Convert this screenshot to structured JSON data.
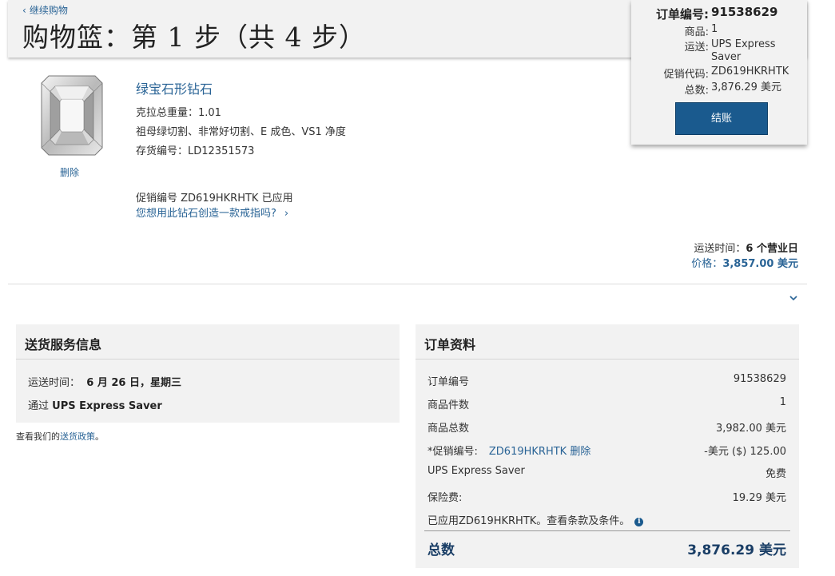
{
  "header": {
    "continue_label": "继续购物",
    "title": "购物篮：第 1 步（共 4 步）"
  },
  "summary": {
    "order_no_label": "订单编号:",
    "order_no": "91538629",
    "items_label": "商品:",
    "items": "1",
    "shipping_label": "运送:",
    "shipping": "UPS Express Saver",
    "promo_label": "促销代码:",
    "promo": "ZD619HKRHTK",
    "total_label": "总数:",
    "total": "3,876.29 美元",
    "checkout_label": "结账"
  },
  "item": {
    "name": "绿宝石形钻石",
    "carat": "克拉总重量：1.01",
    "desc": "祖母绿切割、非常好切割、E 成色、VS1 净度",
    "stock": "存货编号：LD12351573",
    "remove_label": "删除",
    "promo_applied": "促销编号 ZD619HKRHTK 已应用",
    "ring_link": "您想用此钻石创造一款戒指吗?",
    "ship_time_label": "运送时间：",
    "ship_time": "6 个营业日",
    "price_label": "价格：",
    "price": "3,857.00 美元"
  },
  "delivery": {
    "title": "送货服务信息",
    "time_label": "运送时间：",
    "time_value": "6 月 26 日，星期三",
    "via_label": "通过",
    "via_value": "UPS Express Saver",
    "policy_prefix": "查看我们的",
    "policy_link": "送货政策",
    "policy_suffix": "。"
  },
  "order": {
    "title": "订单资料",
    "rows": [
      {
        "label": "订单编号",
        "value": "91538629"
      },
      {
        "label": "商品件数",
        "value": "1"
      },
      {
        "label": "商品总数",
        "value": "3,982.00 美元"
      },
      {
        "label": "*促销编号:",
        "code": "ZD619HKRHTK 删除",
        "value": "-美元 ($) 125.00"
      },
      {
        "label": "UPS Express Saver",
        "value": "免费"
      },
      {
        "label": "保险费:",
        "value": "19.29 美元"
      }
    ],
    "applied_note": "已应用ZD619HKRHTK。查看条款及条件。",
    "total_label": "总数",
    "total_value": "3,876.29 美元"
  }
}
